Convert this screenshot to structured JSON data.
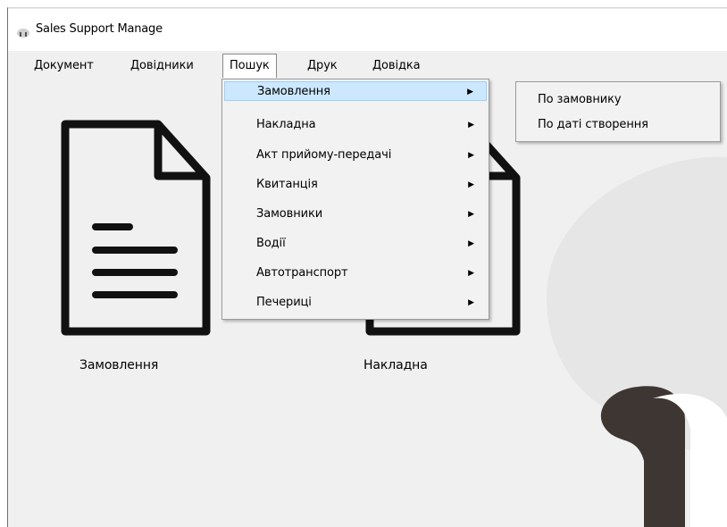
{
  "window": {
    "title": "Sales Support Manage"
  },
  "menubar": {
    "items": [
      "Документ",
      "Довідники",
      "Пошук",
      "Друк",
      "Довідка"
    ]
  },
  "tiles": [
    {
      "label": "Замовлення",
      "icon": "document-icon"
    },
    {
      "label": "Накладна",
      "icon": "document-icon"
    }
  ],
  "search_menu": {
    "items": [
      "Замовлення",
      "Накладна",
      "Акт прийому-передачі",
      "Квитанція",
      "Замовники",
      "Водії",
      "Автотранспорт",
      "Печериці"
    ],
    "active_index": 0,
    "submenu_arrow": "▶"
  },
  "submenu": {
    "items": [
      "По замовнику",
      "По даті створення"
    ]
  }
}
